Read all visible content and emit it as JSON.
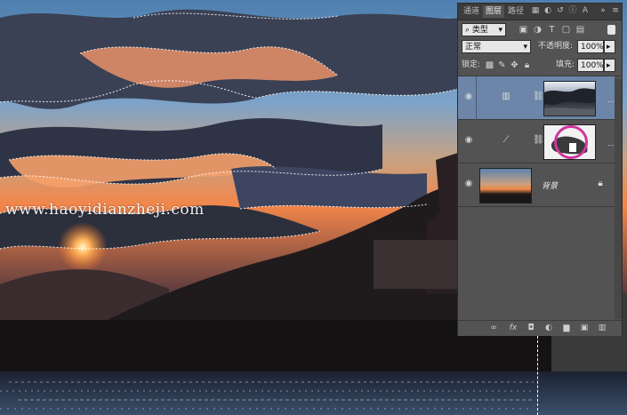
{
  "watermark": "www.haoyidianzheji.com",
  "panel": {
    "tabs": [
      {
        "label": "通道",
        "active": false
      },
      {
        "label": "图层",
        "active": true
      },
      {
        "label": "路径",
        "active": false
      }
    ],
    "tab_icons": [
      "style-icon",
      "adjust-icon",
      "history-icon",
      "info-icon",
      "char-icon"
    ],
    "filter": {
      "kind_label": "类型",
      "icons": [
        "pixel-filter-icon",
        "adjust-filter-icon",
        "type-filter-icon",
        "shape-filter-icon",
        "smart-filter-icon"
      ]
    },
    "blend": {
      "mode": "正常",
      "opacity_label": "不透明度:",
      "opacity_value": "100%"
    },
    "lock": {
      "label": "锁定:",
      "fill_label": "填充:",
      "fill_value": "100%"
    },
    "layers": [
      {
        "type": "levels",
        "name": "",
        "selected": true
      },
      {
        "type": "curves",
        "name": "",
        "selected": false
      },
      {
        "type": "pixel",
        "name": "背景",
        "selected": false,
        "locked": true
      }
    ],
    "bottom_icons": [
      "link-icon",
      "fx-icon",
      "mask-icon",
      "adjustment-icon",
      "group-icon",
      "new-layer-icon",
      "trash-icon"
    ],
    "bottom_glyphs": [
      "∞",
      "fx",
      "◘",
      "◐",
      "▆",
      "▣",
      "▥"
    ],
    "accent": "#6c85a8",
    "highlight": "#d0359c"
  }
}
